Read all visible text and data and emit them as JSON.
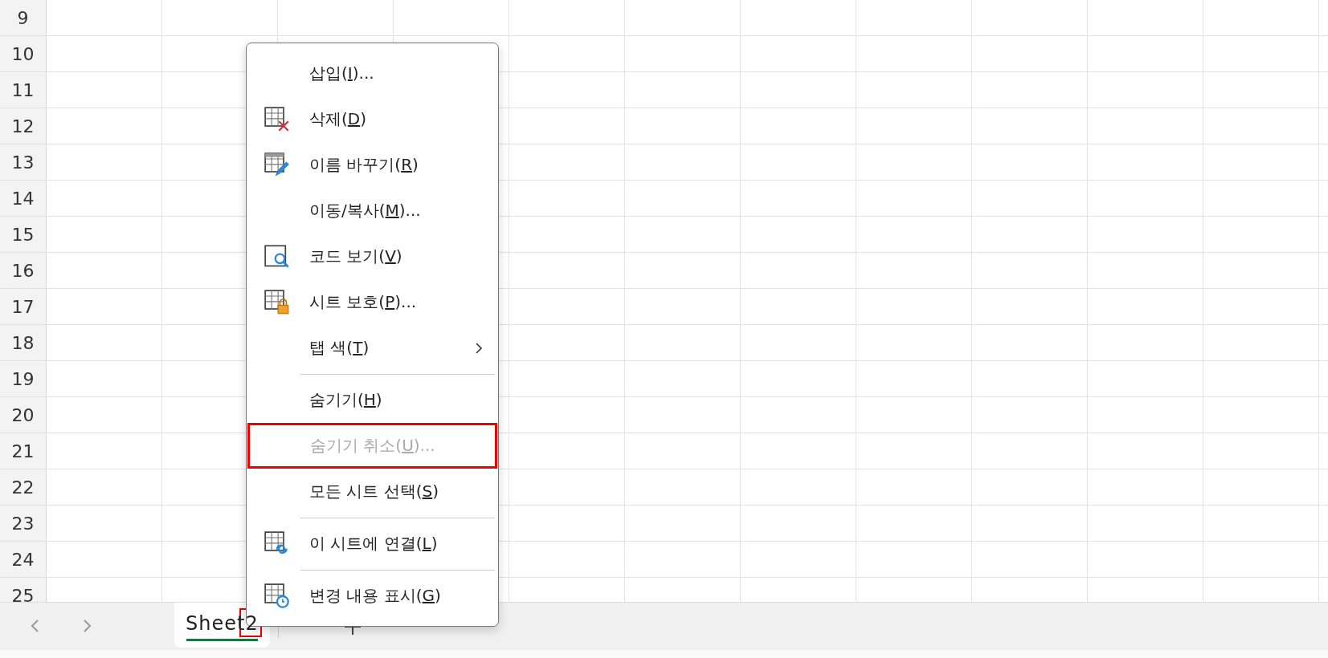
{
  "sheet": {
    "row_headers": [
      "9",
      "10",
      "11",
      "12",
      "13",
      "14",
      "15",
      "16",
      "17",
      "18",
      "19",
      "20",
      "21",
      "22",
      "23",
      "24",
      "25"
    ]
  },
  "tab_bar": {
    "tabs": [
      {
        "label": "Sheet2",
        "selected": true,
        "marked": true
      }
    ]
  },
  "context_menu": {
    "items": [
      {
        "kind": "item",
        "before": "삽입(",
        "key": "I",
        "after": ")...",
        "disabled": false,
        "highlighted": false,
        "submenu": false
      },
      {
        "kind": "item",
        "before": "삭제(",
        "key": "D",
        "after": ")",
        "disabled": false,
        "highlighted": false,
        "submenu": false
      },
      {
        "kind": "item",
        "before": "이름 바꾸기(",
        "key": "R",
        "after": ")",
        "disabled": false,
        "highlighted": false,
        "submenu": false
      },
      {
        "kind": "item",
        "before": "이동/복사(",
        "key": "M",
        "after": ")...",
        "disabled": false,
        "highlighted": false,
        "submenu": false
      },
      {
        "kind": "item",
        "before": "코드 보기(",
        "key": "V",
        "after": ")",
        "disabled": false,
        "highlighted": false,
        "submenu": false
      },
      {
        "kind": "item",
        "before": "시트 보호(",
        "key": "P",
        "after": ")...",
        "disabled": false,
        "highlighted": false,
        "submenu": false
      },
      {
        "kind": "item",
        "before": "탭 색(",
        "key": "T",
        "after": ")",
        "disabled": false,
        "highlighted": false,
        "submenu": true
      },
      {
        "kind": "separator"
      },
      {
        "kind": "item",
        "before": "숨기기(",
        "key": "H",
        "after": ")",
        "disabled": false,
        "highlighted": false,
        "submenu": false
      },
      {
        "kind": "item",
        "before": "숨기기 취소(",
        "key": "U",
        "after": ")...",
        "disabled": true,
        "highlighted": true,
        "submenu": false
      },
      {
        "kind": "item",
        "before": "모든 시트 선택(",
        "key": "S",
        "after": ")",
        "disabled": false,
        "highlighted": false,
        "submenu": false
      },
      {
        "kind": "separator"
      },
      {
        "kind": "item",
        "before": "이 시트에 연결(",
        "key": "L",
        "after": ")",
        "disabled": false,
        "highlighted": false,
        "submenu": false
      },
      {
        "kind": "separator"
      },
      {
        "kind": "item",
        "before": "변경 내용 표시(",
        "key": "G",
        "after": ")",
        "disabled": false,
        "highlighted": false,
        "submenu": false
      }
    ]
  }
}
